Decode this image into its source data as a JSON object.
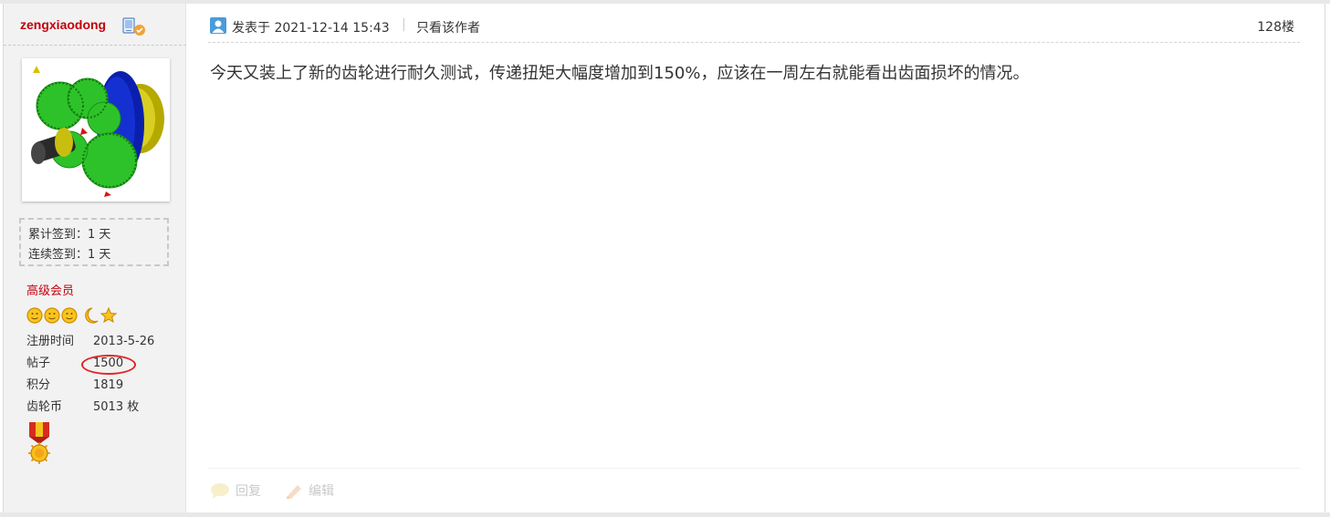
{
  "author": {
    "name": "zengxiaodong",
    "avatar_alt": "",
    "sign": {
      "total_label": "累计签到：",
      "total_value": "1 天",
      "streak_label": "连续签到：",
      "streak_value": "1 天"
    },
    "group": "高级会员",
    "stats": [
      {
        "label": "注册时间",
        "value": "2013-5-26"
      },
      {
        "label": "帖子",
        "value": "1500"
      },
      {
        "label": "积分",
        "value": "1819"
      },
      {
        "label": "齿轮币",
        "value": "5013 枚"
      }
    ]
  },
  "post": {
    "posted_at": "发表于 2021-12-14 15:43",
    "separator": "|",
    "only_author_label": "只看该作者",
    "floor": "128楼",
    "content": "今天又装上了新的齿轮进行耐久测试，传递扭矩大幅度增加到150%，应该在一周左右就能看出齿面损坏的情况。",
    "reply_label": "回复",
    "edit_label": "编辑"
  },
  "colors": {
    "author_name": "#c2000b",
    "group": "#c2000b",
    "highlight_ring": "#e0262a",
    "sidebar_bg": "#f2f2f2",
    "footer_action": "#c9c9c9"
  },
  "icons": {
    "online": "online-status-icon",
    "author": "user-icon",
    "rank": [
      "sun-icon",
      "sun-icon",
      "sun-icon",
      "moon-icon",
      "star-icon"
    ],
    "medal": "medal-icon",
    "reply": "reply-icon",
    "edit": "edit-icon"
  }
}
